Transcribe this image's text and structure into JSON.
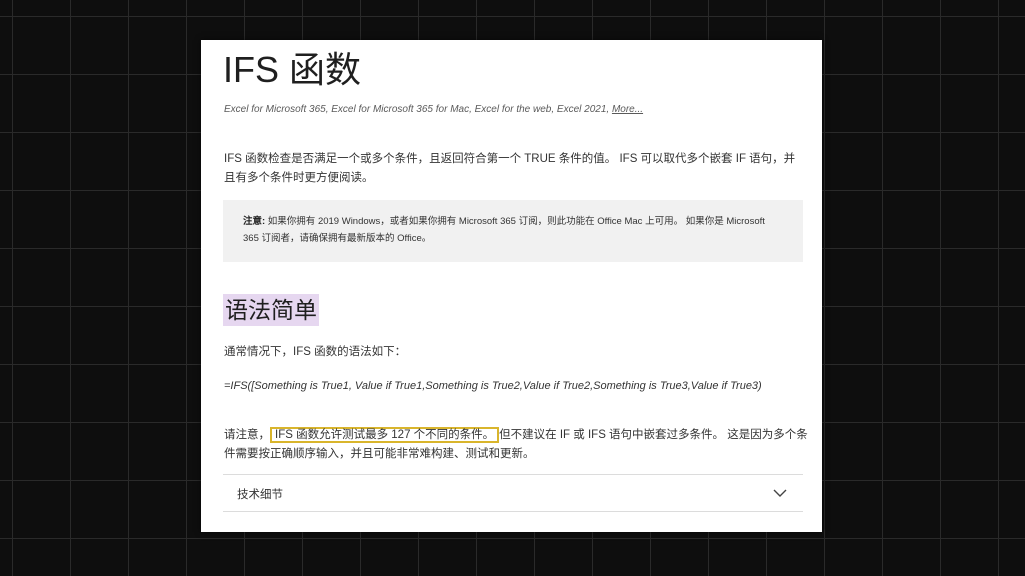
{
  "article": {
    "title": "IFS 函数",
    "applies_to": "Excel for Microsoft 365, Excel for Microsoft 365 for Mac, Excel for the web, Excel 2021,",
    "more_link": "More...",
    "intro": "IFS 函数检查是否满足一个或多个条件，且返回符合第一个 TRUE 条件的值。 IFS 可以取代多个嵌套 IF 语句，并且有多个条件时更方便阅读。",
    "note": {
      "label": "注意:",
      "text": " 如果你拥有 2019 Windows，或者如果你拥有 Microsoft 365 订阅，则此功能在 Office Mac 上可用。 如果你是 Microsoft 365 订阅者，请确保拥有最新版本的 Office。"
    },
    "section_heading": "语法简单",
    "syntax_intro": "通常情况下，IFS 函数的语法如下：",
    "formula": "=IFS([Something is True1, Value if True1,Something is True2,Value if True2,Something is True3,Value if True3)",
    "caution": {
      "prefix": "请注意，",
      "highlight": "IFS 函数允许测试最多 127 个不同的条件。",
      "suffix": "但不建议在 IF 或 IFS 语句中嵌套过多条件。 这是因为多个条件需要按正确顺序输入，并且可能非常难构建、测试和更新。"
    },
    "accordion_label": "技术细节"
  },
  "icons": {
    "accordion_toggle": "chevron-down-icon"
  },
  "colors": {
    "heading_highlight": "#e6d7f0",
    "callout_border": "#d9b52c",
    "note_background": "#f1f1f1"
  }
}
